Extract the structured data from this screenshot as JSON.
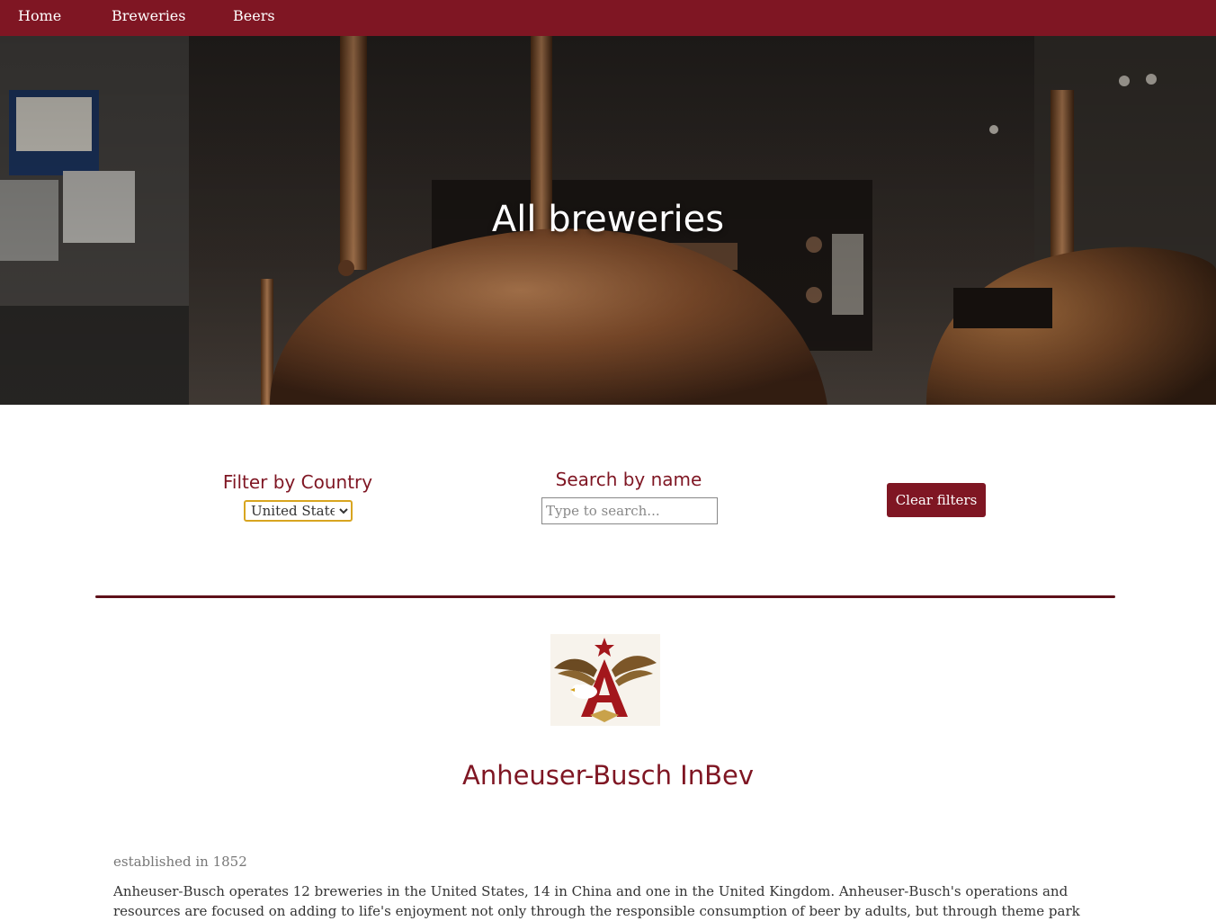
{
  "nav": {
    "items": [
      {
        "label": "Home"
      },
      {
        "label": "Breweries"
      },
      {
        "label": "Beers"
      }
    ]
  },
  "hero": {
    "title": "All breweries"
  },
  "filters": {
    "country_label": "Filter by Country",
    "country_selected": "United States",
    "search_label": "Search by name",
    "search_placeholder": "Type to search...",
    "search_value": "",
    "clear_label": "Clear filters"
  },
  "brewery": {
    "logo_icon": "anheuser-busch-eagle-logo",
    "name": "Anheuser-Busch InBev",
    "established": "established in 1852",
    "description": "Anheuser-Busch operates 12 breweries in the United States, 14 in China and one in the United Kingdom. Anheuser-Busch's operations and resources are focused on adding to life's enjoyment not only through the responsible consumption of beer by adults, but through theme park"
  },
  "colors": {
    "brand": "#7f1623",
    "divider": "#5e1019",
    "select_border": "#d8a520"
  }
}
